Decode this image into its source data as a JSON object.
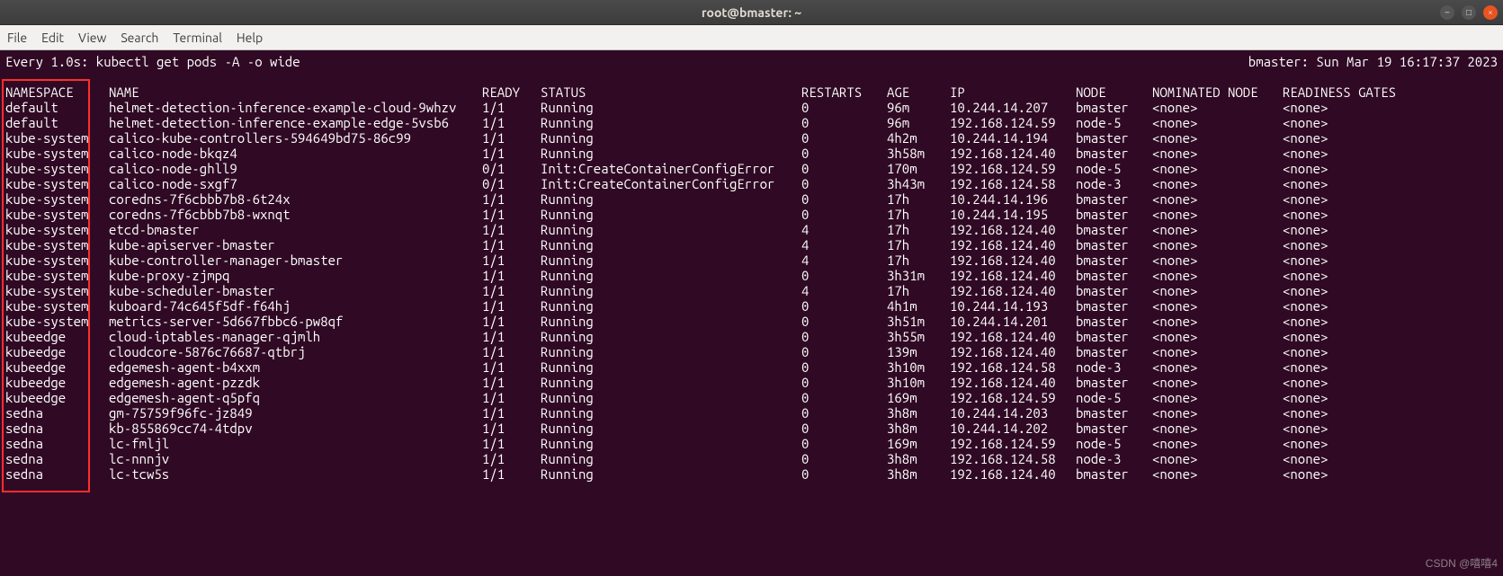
{
  "titlebar": {
    "title": "root@bmaster: ~"
  },
  "menubar": [
    "File",
    "Edit",
    "View",
    "Search",
    "Terminal",
    "Help"
  ],
  "watch": {
    "left": "Every 1.0s: kubectl get pods -A -o wide",
    "right": "bmaster: Sun Mar 19 16:17:37 2023"
  },
  "headers": {
    "namespace": "NAMESPACE",
    "name": "NAME",
    "ready": "READY",
    "status": "STATUS",
    "restarts": "RESTARTS",
    "age": "AGE",
    "ip": "IP",
    "node": "NODE",
    "nominated": "NOMINATED NODE",
    "gates": "READINESS GATES"
  },
  "rows": [
    {
      "ns": "default",
      "name": "helmet-detection-inference-example-cloud-9whzv",
      "ready": "1/1",
      "status": "Running",
      "restarts": "0",
      "age": "96m",
      "ip": "10.244.14.207",
      "node": "bmaster",
      "nom": "<none>",
      "gates": "<none>"
    },
    {
      "ns": "default",
      "name": "helmet-detection-inference-example-edge-5vsb6",
      "ready": "1/1",
      "status": "Running",
      "restarts": "0",
      "age": "96m",
      "ip": "192.168.124.59",
      "node": "node-5",
      "nom": "<none>",
      "gates": "<none>"
    },
    {
      "ns": "kube-system",
      "name": "calico-kube-controllers-594649bd75-86c99",
      "ready": "1/1",
      "status": "Running",
      "restarts": "0",
      "age": "4h2m",
      "ip": "10.244.14.194",
      "node": "bmaster",
      "nom": "<none>",
      "gates": "<none>"
    },
    {
      "ns": "kube-system",
      "name": "calico-node-bkqz4",
      "ready": "1/1",
      "status": "Running",
      "restarts": "0",
      "age": "3h58m",
      "ip": "192.168.124.40",
      "node": "bmaster",
      "nom": "<none>",
      "gates": "<none>"
    },
    {
      "ns": "kube-system",
      "name": "calico-node-ghll9",
      "ready": "0/1",
      "status": "Init:CreateContainerConfigError",
      "restarts": "0",
      "age": "170m",
      "ip": "192.168.124.59",
      "node": "node-5",
      "nom": "<none>",
      "gates": "<none>"
    },
    {
      "ns": "kube-system",
      "name": "calico-node-sxgf7",
      "ready": "0/1",
      "status": "Init:CreateContainerConfigError",
      "restarts": "0",
      "age": "3h43m",
      "ip": "192.168.124.58",
      "node": "node-3",
      "nom": "<none>",
      "gates": "<none>"
    },
    {
      "ns": "kube-system",
      "name": "coredns-7f6cbbb7b8-6t24x",
      "ready": "1/1",
      "status": "Running",
      "restarts": "0",
      "age": "17h",
      "ip": "10.244.14.196",
      "node": "bmaster",
      "nom": "<none>",
      "gates": "<none>"
    },
    {
      "ns": "kube-system",
      "name": "coredns-7f6cbbb7b8-wxnqt",
      "ready": "1/1",
      "status": "Running",
      "restarts": "0",
      "age": "17h",
      "ip": "10.244.14.195",
      "node": "bmaster",
      "nom": "<none>",
      "gates": "<none>"
    },
    {
      "ns": "kube-system",
      "name": "etcd-bmaster",
      "ready": "1/1",
      "status": "Running",
      "restarts": "4",
      "age": "17h",
      "ip": "192.168.124.40",
      "node": "bmaster",
      "nom": "<none>",
      "gates": "<none>"
    },
    {
      "ns": "kube-system",
      "name": "kube-apiserver-bmaster",
      "ready": "1/1",
      "status": "Running",
      "restarts": "4",
      "age": "17h",
      "ip": "192.168.124.40",
      "node": "bmaster",
      "nom": "<none>",
      "gates": "<none>"
    },
    {
      "ns": "kube-system",
      "name": "kube-controller-manager-bmaster",
      "ready": "1/1",
      "status": "Running",
      "restarts": "4",
      "age": "17h",
      "ip": "192.168.124.40",
      "node": "bmaster",
      "nom": "<none>",
      "gates": "<none>"
    },
    {
      "ns": "kube-system",
      "name": "kube-proxy-zjmpq",
      "ready": "1/1",
      "status": "Running",
      "restarts": "0",
      "age": "3h31m",
      "ip": "192.168.124.40",
      "node": "bmaster",
      "nom": "<none>",
      "gates": "<none>"
    },
    {
      "ns": "kube-system",
      "name": "kube-scheduler-bmaster",
      "ready": "1/1",
      "status": "Running",
      "restarts": "4",
      "age": "17h",
      "ip": "192.168.124.40",
      "node": "bmaster",
      "nom": "<none>",
      "gates": "<none>"
    },
    {
      "ns": "kube-system",
      "name": "kuboard-74c645f5df-f64hj",
      "ready": "1/1",
      "status": "Running",
      "restarts": "0",
      "age": "4h1m",
      "ip": "10.244.14.193",
      "node": "bmaster",
      "nom": "<none>",
      "gates": "<none>"
    },
    {
      "ns": "kube-system",
      "name": "metrics-server-5d667fbbc6-pw8qf",
      "ready": "1/1",
      "status": "Running",
      "restarts": "0",
      "age": "3h51m",
      "ip": "10.244.14.201",
      "node": "bmaster",
      "nom": "<none>",
      "gates": "<none>"
    },
    {
      "ns": "kubeedge",
      "name": "cloud-iptables-manager-qjmlh",
      "ready": "1/1",
      "status": "Running",
      "restarts": "0",
      "age": "3h55m",
      "ip": "192.168.124.40",
      "node": "bmaster",
      "nom": "<none>",
      "gates": "<none>"
    },
    {
      "ns": "kubeedge",
      "name": "cloudcore-5876c76687-qtbrj",
      "ready": "1/1",
      "status": "Running",
      "restarts": "0",
      "age": "139m",
      "ip": "192.168.124.40",
      "node": "bmaster",
      "nom": "<none>",
      "gates": "<none>"
    },
    {
      "ns": "kubeedge",
      "name": "edgemesh-agent-b4xxm",
      "ready": "1/1",
      "status": "Running",
      "restarts": "0",
      "age": "3h10m",
      "ip": "192.168.124.58",
      "node": "node-3",
      "nom": "<none>",
      "gates": "<none>"
    },
    {
      "ns": "kubeedge",
      "name": "edgemesh-agent-pzzdk",
      "ready": "1/1",
      "status": "Running",
      "restarts": "0",
      "age": "3h10m",
      "ip": "192.168.124.40",
      "node": "bmaster",
      "nom": "<none>",
      "gates": "<none>"
    },
    {
      "ns": "kubeedge",
      "name": "edgemesh-agent-q5pfq",
      "ready": "1/1",
      "status": "Running",
      "restarts": "0",
      "age": "169m",
      "ip": "192.168.124.59",
      "node": "node-5",
      "nom": "<none>",
      "gates": "<none>"
    },
    {
      "ns": "sedna",
      "name": "gm-75759f96fc-jz849",
      "ready": "1/1",
      "status": "Running",
      "restarts": "0",
      "age": "3h8m",
      "ip": "10.244.14.203",
      "node": "bmaster",
      "nom": "<none>",
      "gates": "<none>"
    },
    {
      "ns": "sedna",
      "name": "kb-855869cc74-4tdpv",
      "ready": "1/1",
      "status": "Running",
      "restarts": "0",
      "age": "3h8m",
      "ip": "10.244.14.202",
      "node": "bmaster",
      "nom": "<none>",
      "gates": "<none>"
    },
    {
      "ns": "sedna",
      "name": "lc-fmljl",
      "ready": "1/1",
      "status": "Running",
      "restarts": "0",
      "age": "169m",
      "ip": "192.168.124.59",
      "node": "node-5",
      "nom": "<none>",
      "gates": "<none>"
    },
    {
      "ns": "sedna",
      "name": "lc-nnnjv",
      "ready": "1/1",
      "status": "Running",
      "restarts": "0",
      "age": "3h8m",
      "ip": "192.168.124.58",
      "node": "node-3",
      "nom": "<none>",
      "gates": "<none>"
    },
    {
      "ns": "sedna",
      "name": "lc-tcw5s",
      "ready": "1/1",
      "status": "Running",
      "restarts": "0",
      "age": "3h8m",
      "ip": "192.168.124.40",
      "node": "bmaster",
      "nom": "<none>",
      "gates": "<none>"
    }
  ],
  "watermark": "CSDN @嘻嘻4"
}
